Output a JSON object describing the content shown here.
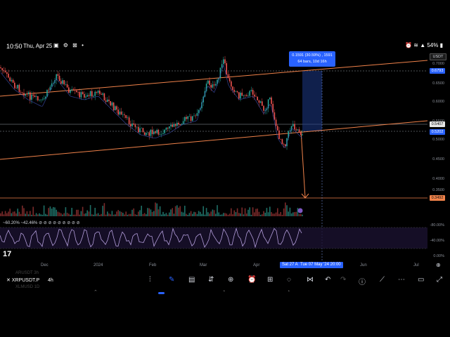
{
  "status_bar": {
    "time": "10:50",
    "date": "Thu, Apr 25",
    "battery": "54%"
  },
  "chart": {
    "currency_badge": "USDT",
    "price_axis": [
      "0.7000",
      "0.6500",
      "0.6000",
      "0.5500",
      "0.5000",
      "0.4500",
      "0.4000",
      "0.3500"
    ],
    "price_tags": {
      "upper": "0.6793",
      "mid": "0.5407",
      "current": "0.5202",
      "target": "0.3492"
    },
    "measure": {
      "line1": "0.1591 (30.59%) , 1591",
      "line2": "64 bars, 10d 16h"
    },
    "rsi": {
      "left_value": "~60.20%",
      "right_value": "~42.46%",
      "axis_labels": [
        "-80.00%",
        "-40.00%",
        "0.00%"
      ]
    },
    "time_axis": [
      "Dec",
      "2024",
      "Feb",
      "Mar",
      "Apr",
      "Jun",
      "Jul"
    ],
    "time_range_box": "Sat 27 A",
    "time_cursor_box": "Tue 07 May '24  20:00",
    "colors": {
      "trendline": "#f0824a",
      "bull": "#26a69a",
      "bear": "#ef5350",
      "accent": "#2962ff",
      "rsi": "#7e57c2"
    }
  },
  "toolbar": {
    "symbol": "XRPUSDT.P",
    "timeframe": "4h",
    "ghost_top": "ARUSDT  3h",
    "ghost_bottom": "XLMUSD  1D"
  }
}
